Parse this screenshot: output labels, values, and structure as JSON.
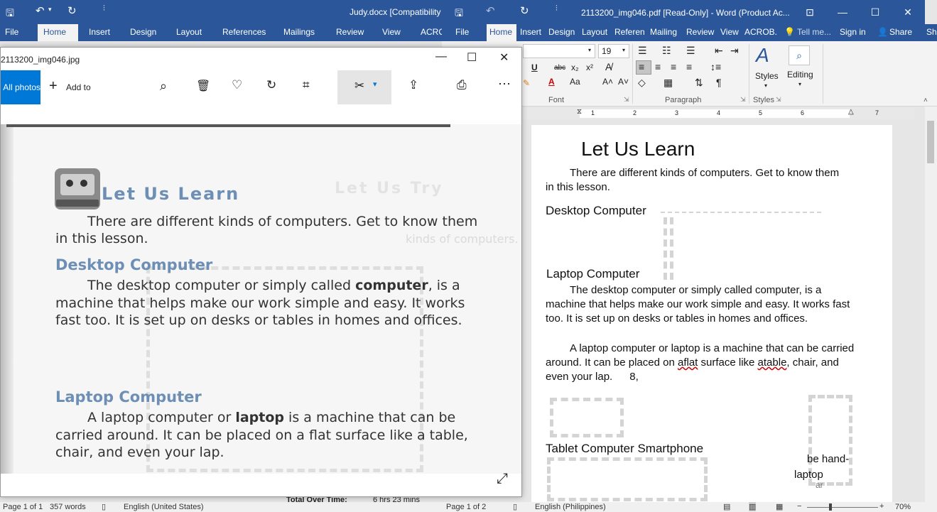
{
  "back_window": {
    "title": "Judy.docx [Compatibility",
    "tabs": [
      "File",
      "Home",
      "Insert",
      "Design",
      "Layout",
      "References",
      "Mailings",
      "Review",
      "View",
      "ACRO"
    ],
    "status": {
      "page": "Page 1 of 1",
      "words": "357 words",
      "lang": "English (United States)",
      "overlay": "Total Over Time:",
      "time": "6 hrs 23 mins"
    }
  },
  "front_window": {
    "title": "2113200_img046.pdf [Read-Only] - Word (Product Ac...",
    "tabs": [
      "File",
      "Home",
      "Insert",
      "Design",
      "Layout",
      "Referen",
      "Mailing",
      "Review",
      "View",
      "ACROB.",
      "Tell me...",
      "Sign in",
      "Share",
      "Sh"
    ],
    "ribbon": {
      "font_size": "19",
      "groups": [
        "Font",
        "Paragraph",
        "Styles"
      ],
      "styles_label": "Styles",
      "editing_label": "Editing"
    },
    "ruler": [
      "1",
      "2",
      "3",
      "4",
      "5",
      "6",
      "7"
    ],
    "doc": {
      "title": "Let Us Learn",
      "intro": "There are different kinds of computers. Get to know them in this lesson.",
      "h1": "Desktop Computer",
      "h2": "Laptop Computer",
      "p1": "The desktop computer or simply called computer, is a machine that helps make our work simple and easy. It works fast too. It is set up on desks or tables in homes and offices.",
      "p2a": "A laptop computer or laptop is a machine that can be carried around. It can be placed on ",
      "p2_err1": "aflat",
      "p2b": " surface like ",
      "p2_err2": "atable",
      "p2c": ", chair, and even your lap.",
      "p2_num": "8,",
      "h3": "Tablet Computer Smartphone",
      "frag1": "be hand-",
      "frag2": "laptop",
      "frag3": "ar"
    },
    "status": {
      "page": "Page 1 of 2",
      "lang": "English (Philippines)",
      "zoom": "70%"
    }
  },
  "photos": {
    "title": "2113200_img046.jpg",
    "all_photos": "All photos",
    "add_to": "Add to",
    "scan": {
      "title": "Let Us Learn",
      "intro1": "There are different kinds of computers. Get to know them",
      "intro2": "in this lesson.",
      "h1": "Desktop Computer",
      "p1a": "The desktop computer or simply called ",
      "p1b": "computer",
      "p1c": ", is a",
      "p1d": "machine that helps make our work simple and easy. It works",
      "p1e": "fast too. It is set up on desks or tables in homes and offices.",
      "h2": "Laptop Computer",
      "p2a": "A laptop computer or ",
      "p2b": "laptop",
      "p2c": " is a machine that can be",
      "p2d": "carried around. It can be placed on a flat surface like a table,",
      "p2e": "chair, and even your lap.",
      "ghost1": "Let Us Try",
      "ghost2": "kinds of computers."
    }
  },
  "colors": {
    "word_blue": "#2b579a",
    "accent": "#0078d7",
    "scan_heading": "#6d8fb5"
  }
}
